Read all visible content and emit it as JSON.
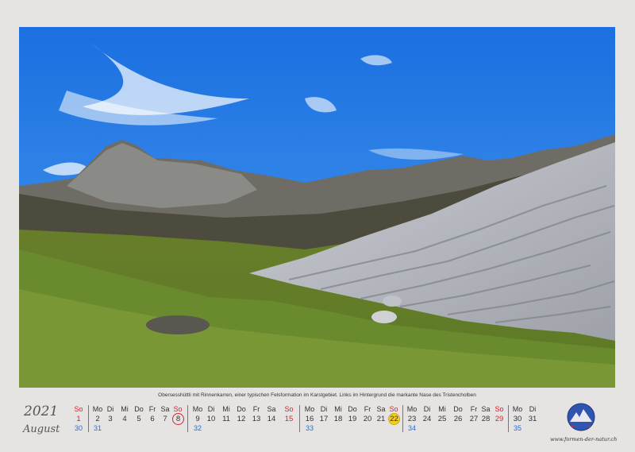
{
  "photo": {
    "caption": "Obersesshüttli mit Rinnenkarren, einer typischen Felsformation im Karstgebiet. Links im Hintergrund die markante Nase des Tristencholben"
  },
  "header": {
    "year": "2021",
    "month": "August"
  },
  "calendar": {
    "weeks": [
      {
        "headers": [
          "So"
        ],
        "days": [
          "1"
        ],
        "week_numbers": [
          "30",
          "31"
        ]
      },
      {
        "headers": [
          "Mo",
          "Di",
          "Mi",
          "Do",
          "Fr",
          "Sa",
          "So"
        ],
        "days": [
          "2",
          "3",
          "4",
          "5",
          "6",
          "7",
          "8"
        ],
        "week_number": "32"
      },
      {
        "headers": [
          "Mo",
          "Di",
          "Mi",
          "Do",
          "Fr",
          "Sa",
          "So"
        ],
        "days": [
          "9",
          "10",
          "11",
          "12",
          "13",
          "14",
          "15"
        ],
        "week_number": "33"
      },
      {
        "headers": [
          "Mo",
          "Di",
          "Mi",
          "Do",
          "Fr",
          "Sa",
          "So"
        ],
        "days": [
          "16",
          "17",
          "18",
          "19",
          "20",
          "21",
          "22"
        ],
        "week_number": "34"
      },
      {
        "headers": [
          "Mo",
          "Di",
          "Mi",
          "Do",
          "Fr",
          "Sa",
          "So"
        ],
        "days": [
          "23",
          "24",
          "25",
          "26",
          "27",
          "28",
          "29"
        ],
        "week_number": "35"
      },
      {
        "headers": [
          "Mo",
          "Di"
        ],
        "days": [
          "30",
          "31"
        ]
      }
    ],
    "sunday_color": "#d8232a",
    "weeknumber_color": "#2a6fd0",
    "today_color": "#f4cf20"
  },
  "footer": {
    "url": "www.formen-der-natur.ch",
    "logo_icon": "globe-mountain-logo-icon"
  }
}
